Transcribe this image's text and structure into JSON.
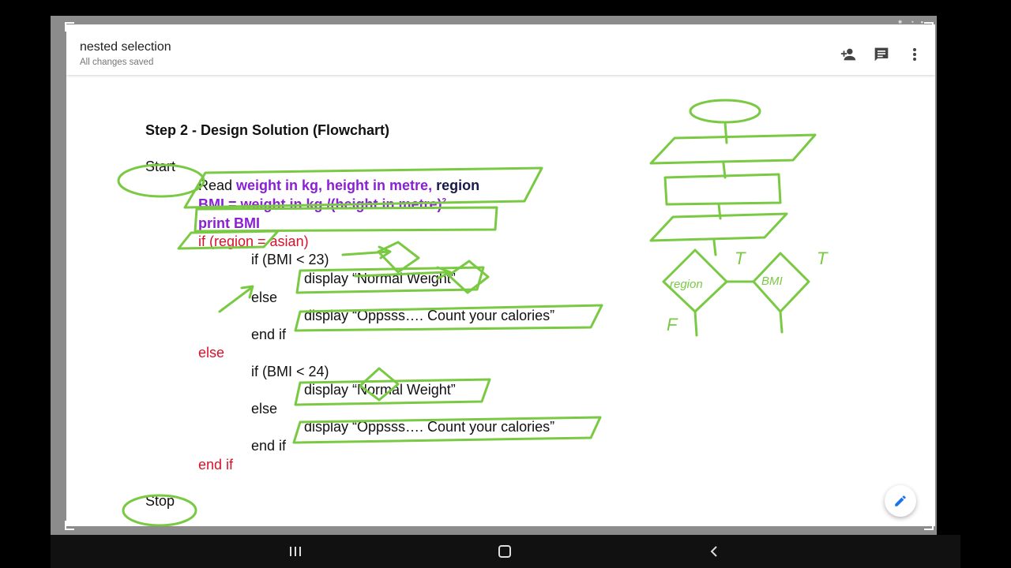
{
  "app": {
    "doc_title": "nested selection",
    "save_status": "All changes saved"
  },
  "toolbar": {
    "add_person_icon": "person-add-icon",
    "comment_icon": "comment-icon",
    "more_icon": "more-vert-icon"
  },
  "slide": {
    "heading": "Step 2 - Design Solution (Flowchart)",
    "start_label": "Start",
    "stop_label": "Stop",
    "read_kw": "Read",
    "read_vars": "weight in kg, height in metre,",
    "read_region": "region",
    "bmi_line": "BMI =  weight in kg /(height in metre)",
    "bmi_sup": "2",
    "print_line": "print BMI",
    "if_region": "if (region = asian)",
    "if_bmi_23": "if (BMI < 23)",
    "display_normal_1": "display “Normal Weight”",
    "else_inner_1": "else",
    "display_oops_1": "display “Oppsss…. Count your calories”",
    "endif_inner_1": "end if",
    "else_outer": "else",
    "if_bmi_24": "if (BMI < 24)",
    "display_normal_2": "display “Normal Weight”",
    "else_inner_2": "else",
    "display_oops_2": "display “Oppsss…. Count your calories”",
    "endif_inner_2": "end if",
    "endif_outer": "end if"
  },
  "sketch": {
    "label_region": "region",
    "label_t1": "T",
    "label_bmi": "BMI",
    "label_t2": "T",
    "label_f": "F"
  },
  "colors": {
    "ink_green": "#7ac943",
    "keyword_purple": "#8a1fd6",
    "keyword_red": "#d6122b"
  },
  "edit_fab_icon": "pencil-icon",
  "navbar": {
    "recents_icon": "recent-apps-icon",
    "home_icon": "home-icon",
    "back_icon": "back-icon"
  }
}
